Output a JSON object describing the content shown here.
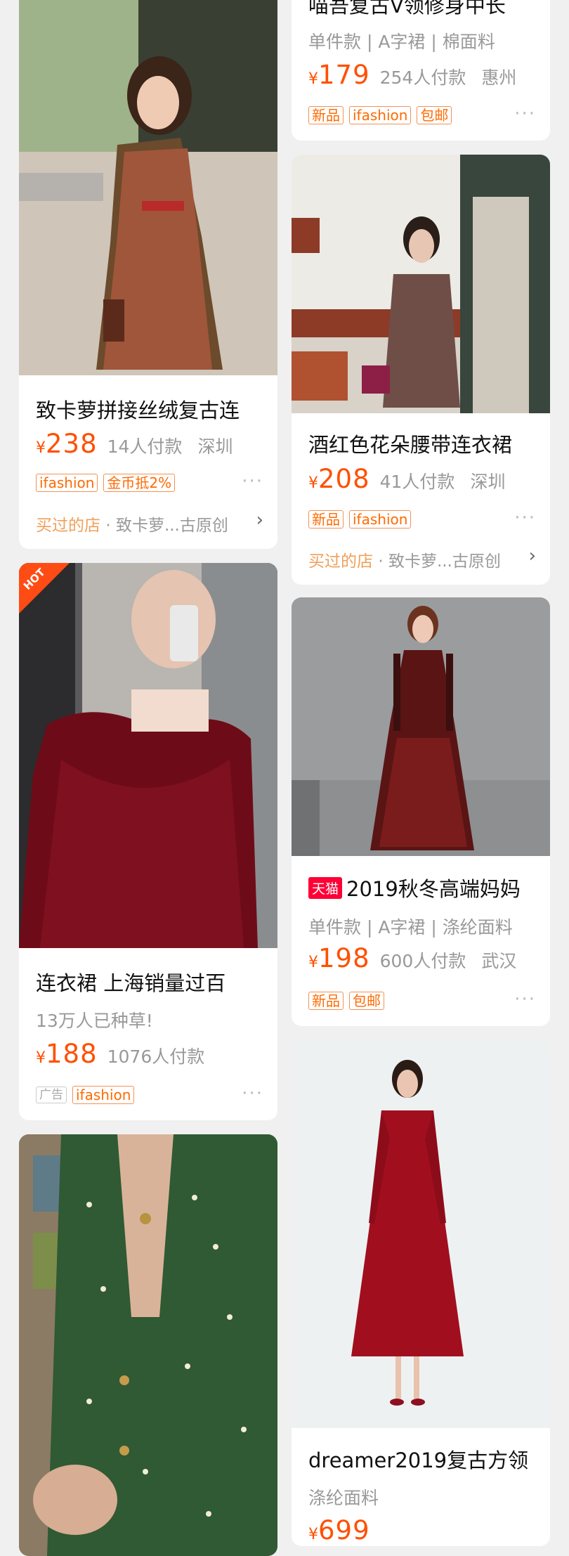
{
  "cards": [
    {
      "title": "致卡萝拼接丝绒复古连",
      "price_symbol": "¥",
      "price": "238",
      "sales": "14人付款",
      "location": "深圳",
      "tags": [
        "ifashion",
        "金币抵2%"
      ],
      "more": "···",
      "shop_prefix": "买过的店",
      "shop_sep": "·",
      "shop_name": "致卡萝...古原创",
      "shop_arrow": "›"
    },
    {
      "title_partial": "喵吾复古V领修身中长",
      "attrs": "单件款 | A字裙 | 棉面料",
      "price_symbol": "¥",
      "price": "179",
      "sales": "254人付款",
      "location": "惠州",
      "tags": [
        "新品",
        "ifashion",
        "包邮"
      ],
      "more": "···"
    },
    {
      "title": "酒红色花朵腰带连衣裙",
      "price_symbol": "¥",
      "price": "208",
      "sales": "41人付款",
      "location": "深圳",
      "tags": [
        "新品",
        "ifashion"
      ],
      "more": "···",
      "shop_prefix": "买过的店",
      "shop_sep": "·",
      "shop_name": "致卡萝...古原创",
      "shop_arrow": "›"
    },
    {
      "badge": "HOT",
      "title": "连衣裙 上海销量过百",
      "subtitle": "13万人已种草!",
      "price_symbol": "¥",
      "price": "188",
      "sales": "1076人付款",
      "ad_label": "广告",
      "tags": [
        "ifashion"
      ],
      "more": "···"
    },
    {
      "store_badge": "天猫",
      "title": "2019秋冬高端妈妈",
      "attrs": "单件款 | A字裙 | 涤纶面料",
      "price_symbol": "¥",
      "price": "198",
      "sales": "600人付款",
      "location": "武汉",
      "tags": [
        "新品",
        "包邮"
      ],
      "more": "···"
    },
    {
      "title": "dreamer2019复古方领",
      "attrs": "涤纶面料",
      "price_symbol": "¥",
      "price": "699"
    }
  ],
  "colors": {
    "accent": "#ff5000",
    "tag_border": "#f29257",
    "background": "#f0f0f0",
    "tmall_red": "#ff0036"
  }
}
